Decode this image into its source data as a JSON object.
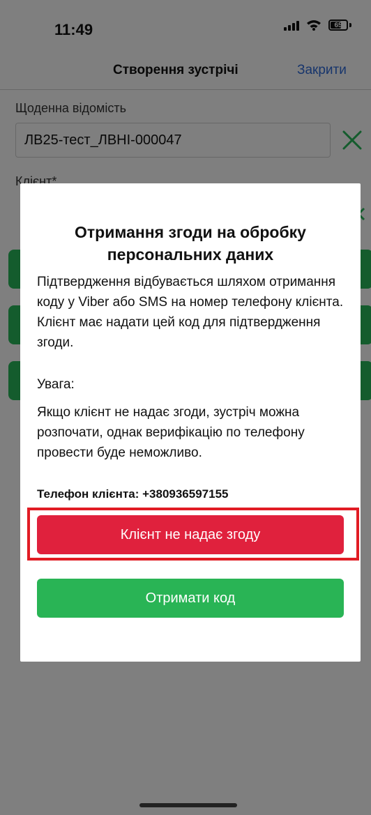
{
  "status_bar": {
    "time": "11:49",
    "battery": "65"
  },
  "nav": {
    "title": "Створення зустрічі",
    "close_label": "Закрити"
  },
  "form": {
    "daily_sheet_label": "Щоденна відомість",
    "daily_sheet_value": "ЛВ25-тест_ЛВНІ-000047",
    "client_label": "Клієнт*"
  },
  "modal": {
    "title": "Отримання згоди на обробку персональних даних",
    "body": "Підтвердження відбувається шляхом отримання коду у Viber або SMS на номер телефону клієнта. Клієнт має надати цей код для підтвердження згоди.",
    "warning_label": "Увага:",
    "warning_text": "Якщо клієнт не надає згоди, зустріч можна розпочати, однак верифікацію по телефону провести буде неможливо.",
    "phone_line": "Телефон клієнта: +380936597155",
    "decline_button": "Клієнт не надає згоду",
    "get_code_button": "Отримати код"
  },
  "colors": {
    "decline": "#e0213d",
    "confirm": "#29b455",
    "highlight": "#e11c24",
    "link": "#2f6bd8",
    "clear_icon": "#28b85a"
  }
}
